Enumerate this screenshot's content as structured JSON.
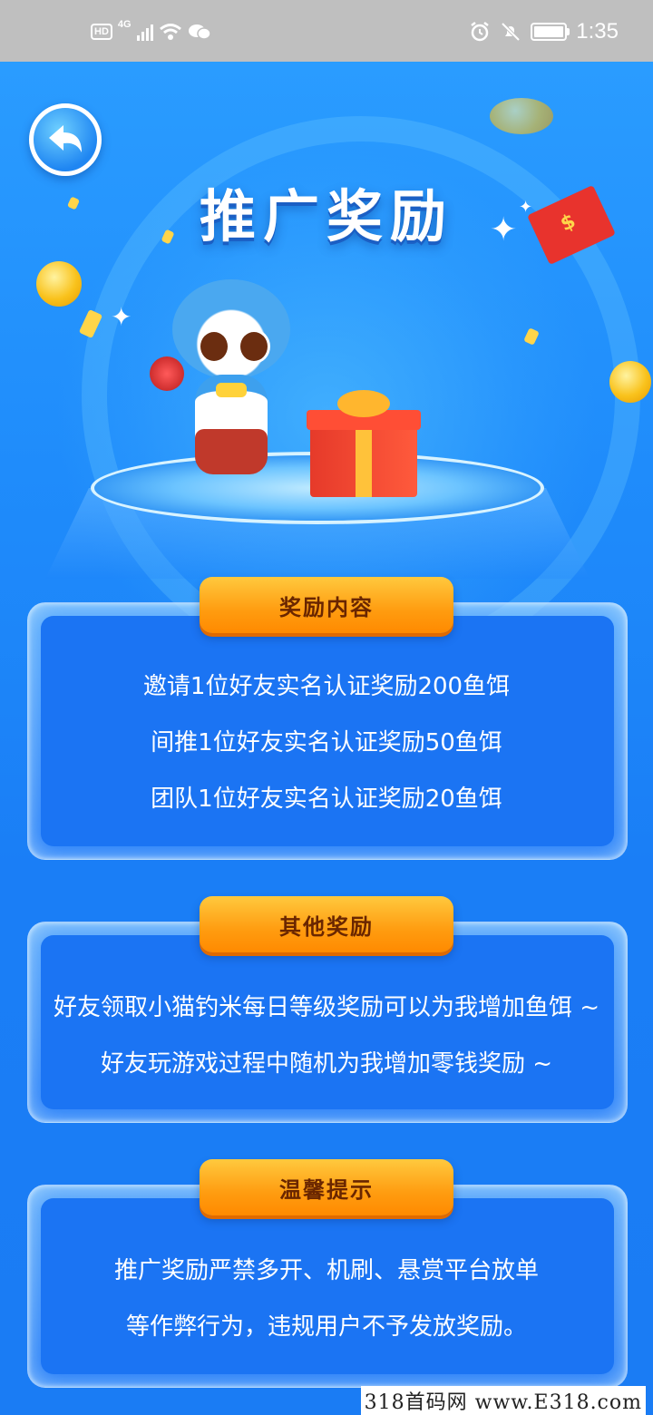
{
  "status_bar": {
    "hd": "HD",
    "net": "4G",
    "time": "1:35"
  },
  "header": {
    "title": "推广奖励"
  },
  "sections": [
    {
      "heading": "奖励内容",
      "lines": [
        "邀请1位好友实名认证奖励200鱼饵",
        "间推1位好友实名认证奖励50鱼饵",
        "团队1位好友实名认证奖励20鱼饵"
      ]
    },
    {
      "heading": "其他奖励",
      "lines": [
        "好友领取小猫钓米每日等级奖励可以为我增加鱼饵 ~",
        "好友玩游戏过程中随机为我增加零钱奖励 ~"
      ]
    },
    {
      "heading": "温馨提示",
      "lines": [
        "推广奖励严禁多开、机刷、悬赏平台放单",
        "等作弊行为，违规用户不予发放奖励。"
      ]
    }
  ],
  "watermark": "318首码网 www.E318.com",
  "colors": {
    "background": "#1a82f8",
    "accent_orange": "#ff9c10",
    "heading_text": "#6a2600"
  },
  "icons": {
    "back": "back-arrow-icon",
    "gift": "gift-box-icon",
    "cat": "cat-mascot-icon"
  }
}
